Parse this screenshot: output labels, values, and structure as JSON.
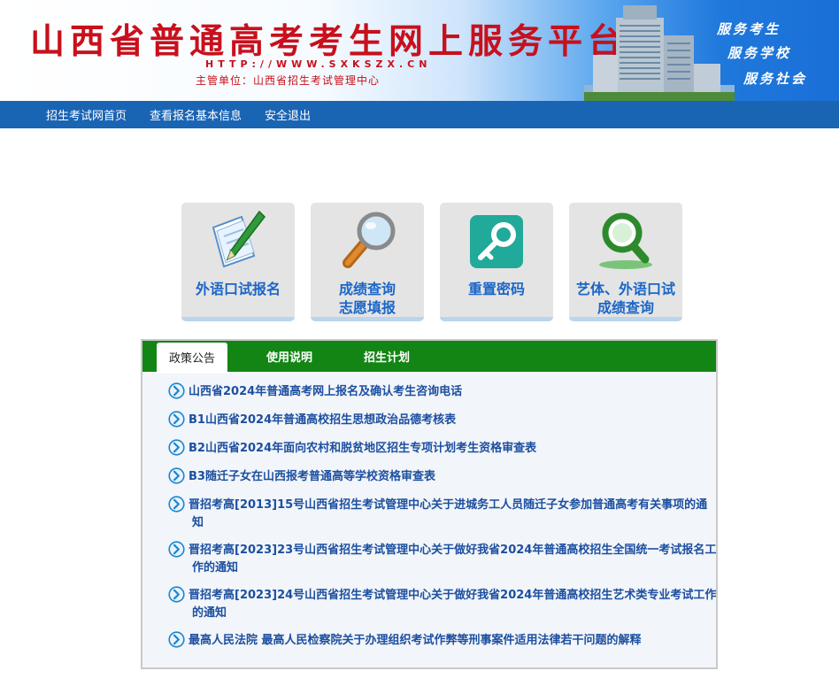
{
  "header": {
    "title": "山西省普通高考考生网上服务平台",
    "url": "HTTP://WWW.SXKSZX.CN",
    "organizer": "主管单位：山西省招生考试管理中心",
    "slogans": [
      "服务考生",
      "服务学校",
      "服务社会"
    ]
  },
  "nav": {
    "items": [
      "招生考试网首页",
      "查看报名基本信息",
      "安全退出"
    ]
  },
  "tiles": [
    {
      "line1": "外语口试报名",
      "line2": "",
      "icon": "pen-paper-icon"
    },
    {
      "line1": "成绩查询",
      "line2": "志愿填报",
      "icon": "magnifier-icon"
    },
    {
      "line1": "重置密码",
      "line2": "",
      "icon": "key-icon"
    },
    {
      "line1": "艺体、外语口试",
      "line2": "成绩查询",
      "icon": "search-green-icon"
    }
  ],
  "tabs": {
    "items": [
      "政策公告",
      "使用说明",
      "招生计划"
    ],
    "active": "政策公告"
  },
  "notices": [
    {
      "text": "山西省2024年普通高考网上报名及确认考生咨询电话"
    },
    {
      "text": "B1山西省2024年普通高校招生思想政治品德考核表"
    },
    {
      "text": "B2山西省2024年面向农村和脱贫地区招生专项计划考生资格审查表"
    },
    {
      "text": "B3随迁子女在山西报考普通高等学校资格审查表"
    },
    {
      "text": "晋招考高[2013]15号山西省招生考试管理中心关于进城务工人员随迁子女参加普通高考有关事项的通知"
    },
    {
      "text": "晋招考高[2023]23号山西省招生考试管理中心关于做好我省2024年普通高校招生全国统一考试报名工作的通知"
    },
    {
      "text": "晋招考高[2023]24号山西省招生考试管理中心关于做好我省2024年普通高校招生艺术类专业考试工作的通知"
    },
    {
      "text": "最高人民法院 最高人民检察院关于办理组织考试作弊等刑事案件适用法律若干问题的解释"
    }
  ],
  "colors": {
    "title_red": "#c8101c",
    "nav_blue": "#1a64b4",
    "tile_text_blue": "#1b66c7",
    "tab_green": "#138514",
    "notice_blue": "#1c4fa0"
  }
}
